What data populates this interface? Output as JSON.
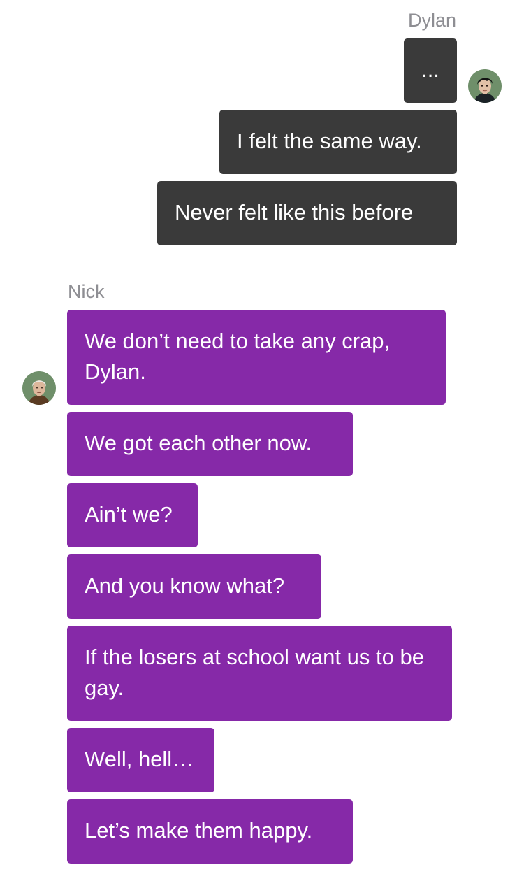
{
  "conversation": {
    "dylan": {
      "name": "Dylan",
      "messages": [
        "...",
        "I felt the same way.",
        "Never felt like this before"
      ]
    },
    "nick": {
      "name": "Nick",
      "messages": [
        "We don’t need to take any crap, Dylan.",
        "We got each other now.",
        "Ain’t we?",
        "And you know what?",
        "If the losers at school want us to be gay.",
        "Well, hell…",
        "Let’s make them happy."
      ]
    }
  },
  "colors": {
    "outgoing_bubble": "#3a3a3a",
    "incoming_bubble": "#8629a8",
    "sender_name": "#8e8e93"
  },
  "icons": {
    "dylan_avatar": "dylan-avatar",
    "nick_avatar": "nick-avatar"
  }
}
